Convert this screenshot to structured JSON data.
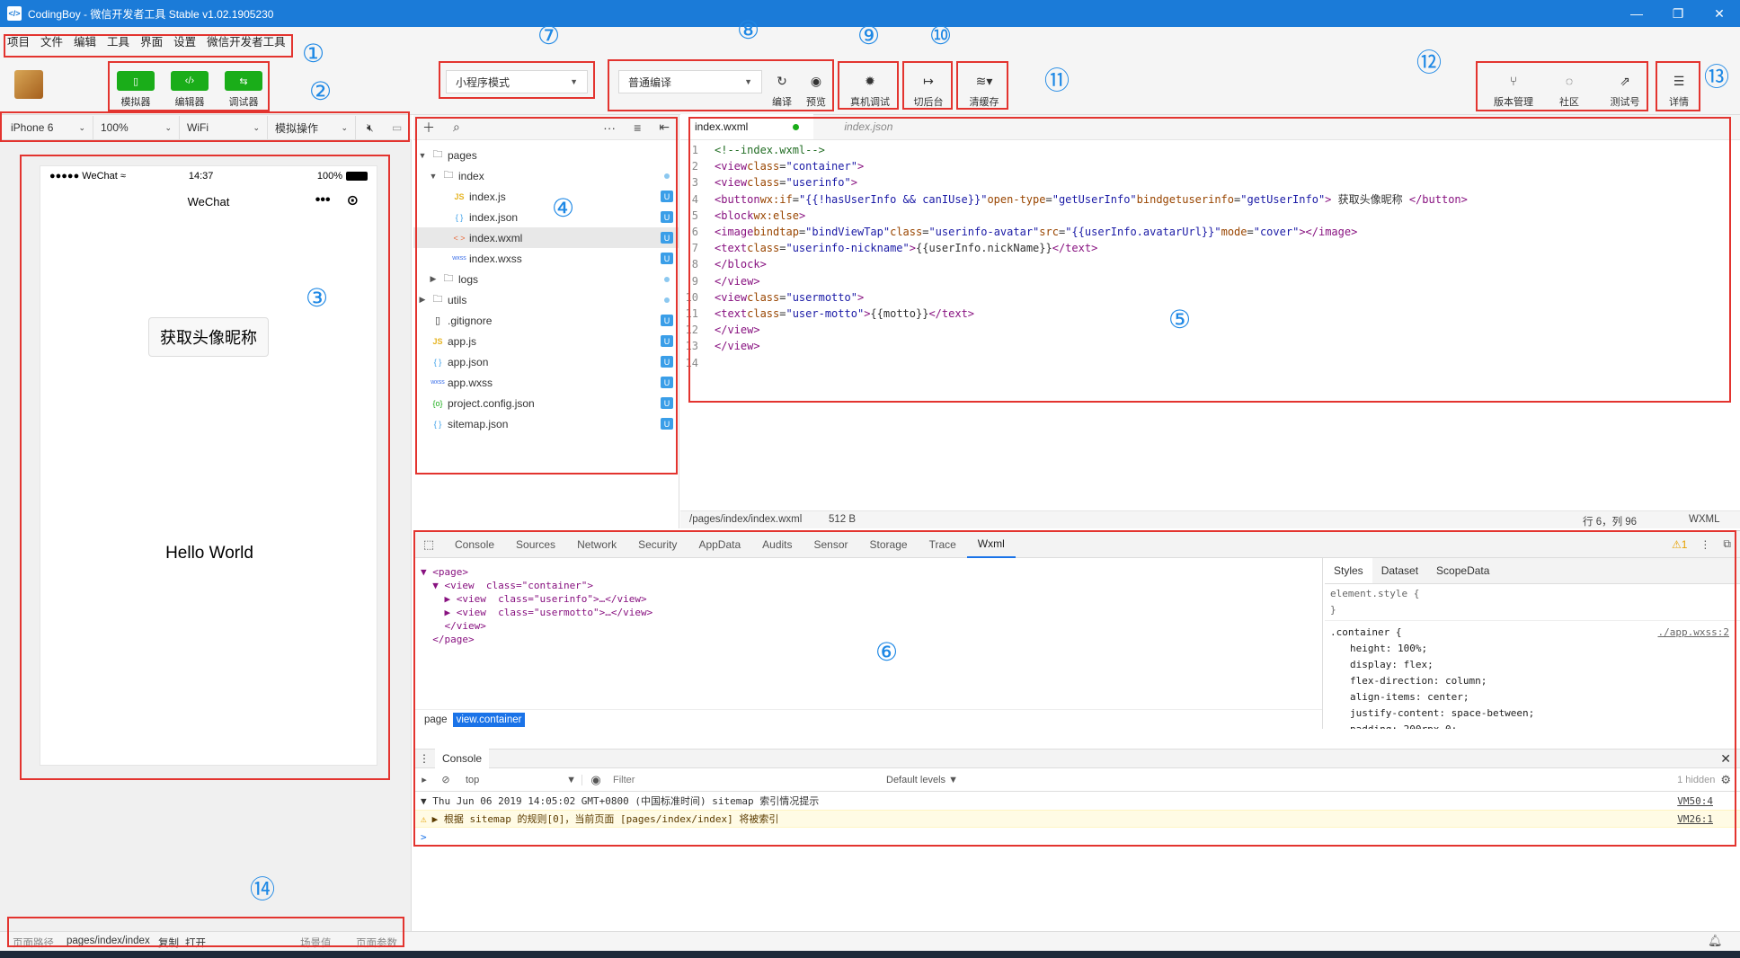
{
  "window": {
    "title": "CodingBoy - 微信开发者工具 Stable v1.02.1905230",
    "minimize": "—",
    "maximize": "❐",
    "close": "✕"
  },
  "menu": [
    "项目",
    "文件",
    "编辑",
    "工具",
    "界面",
    "设置",
    "微信开发者工具"
  ],
  "toolbar": {
    "simulator": "模拟器",
    "editor": "编辑器",
    "debugger": "调试器",
    "mode_select": "小程序模式",
    "compile_select": "普通编译",
    "compile": "编译",
    "preview": "预览",
    "remote_debug": "真机调试",
    "background": "切后台",
    "clear_cache": "清缓存",
    "version": "版本管理",
    "community": "社区",
    "test_account": "测试号",
    "details": "详情"
  },
  "device_bar": {
    "device": "iPhone 6",
    "zoom": "100%",
    "network": "WiFi",
    "operation": "模拟操作"
  },
  "phone": {
    "carrier": "●●●●● WeChat",
    "time": "14:37",
    "battery": "100%",
    "nav_title": "WeChat",
    "button_label": "获取头像昵称",
    "hello": "Hello World"
  },
  "filetree": {
    "items": [
      {
        "name": "pages",
        "type": "folder"
      },
      {
        "name": "index",
        "type": "folder"
      },
      {
        "name": "index.js",
        "icon": "JS"
      },
      {
        "name": "index.json",
        "icon": "{ }"
      },
      {
        "name": "index.wxml",
        "icon": "< >"
      },
      {
        "name": "index.wxss",
        "icon": "wxss"
      },
      {
        "name": "logs",
        "type": "folder"
      },
      {
        "name": "utils",
        "type": "folder"
      },
      {
        "name": ".gitignore",
        "icon": ""
      },
      {
        "name": "app.js",
        "icon": "JS"
      },
      {
        "name": "app.json",
        "icon": "{ }"
      },
      {
        "name": "app.wxss",
        "icon": "wxss"
      },
      {
        "name": "project.config.json",
        "icon": "{o}"
      },
      {
        "name": "sitemap.json",
        "icon": "{ }"
      }
    ],
    "badge": "U"
  },
  "editor": {
    "tab_active": "index.wxml",
    "tab_inactive": "index.json",
    "path": "/pages/index/index.wxml",
    "size": "512 B",
    "cursor": "行 6，列 96",
    "lang": "WXML",
    "line_numbers": [
      "1",
      "2",
      "3",
      "4",
      "5",
      "6",
      "7",
      "8",
      "9",
      "10",
      "11",
      "12",
      "13",
      "14"
    ]
  },
  "devtools": {
    "tabs": [
      "Console",
      "Sources",
      "Network",
      "Security",
      "AppData",
      "Audits",
      "Sensor",
      "Storage",
      "Trace",
      "Wxml"
    ],
    "warn_count": "1",
    "xml_lines": [
      "▼ <page>",
      "  ▼ <view  class=\"container\">",
      "    ▶ <view  class=\"userinfo\">…</view>",
      "    ▶ <view  class=\"usermotto\">…</view>",
      "    </view>",
      "  </page>"
    ],
    "breadcrumb": [
      "page",
      "view.container"
    ],
    "styles_tabs": [
      "Styles",
      "Dataset",
      "ScopeData"
    ],
    "element_style": "element.style {",
    "element_style_close": "}",
    "container_rule": ".container {",
    "container_src": "./app.wxss:2",
    "props": [
      "height: 100%;",
      "display: flex;",
      "flex-direction: column;",
      "align-items: center;",
      "justify-content: space-between;",
      "padding: 200rpx 0;"
    ],
    "console_label": "Console",
    "context": "top",
    "filter_placeholder": "Filter",
    "levels": "Default levels ▼",
    "hidden": "1 hidden",
    "msg1": "▼ Thu Jun 06 2019 14:05:02 GMT+0800 (中国标准时间) sitemap 索引情况提示",
    "msg1_src": "VM50:4",
    "msg2": "▶ 根据 sitemap 的规则[0]，当前页面 [pages/index/index] 将被索引",
    "msg2_src": "VM26:1",
    "prompt": ">"
  },
  "bottom": {
    "path_label": "页面路径",
    "path": "pages/index/index",
    "copy": "复制",
    "open": "打开",
    "scene": "场景值",
    "params": "页面参数"
  },
  "annotations": [
    "①",
    "②",
    "③",
    "④",
    "⑤",
    "⑥",
    "⑦",
    "⑧",
    "⑨",
    "⑩",
    "⑪",
    "⑫",
    "⑬",
    "⑭"
  ],
  "colors": {
    "title_bar": "#1b7bd8",
    "green": "#1aad19",
    "highlight": "#e3342f",
    "annotation": "#1e88e5"
  }
}
